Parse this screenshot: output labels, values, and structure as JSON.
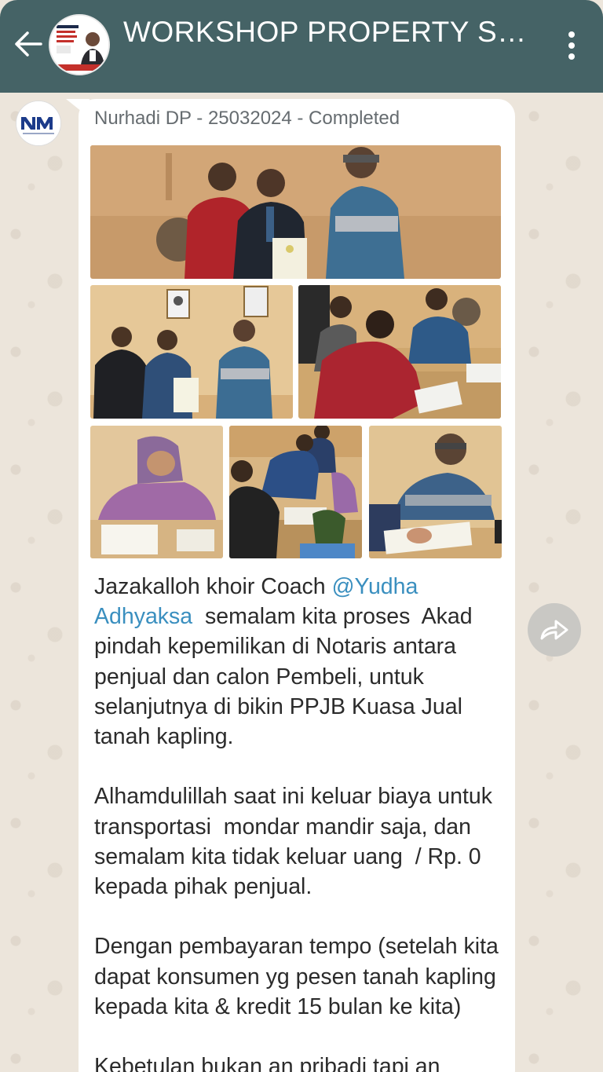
{
  "header": {
    "title": "WORKSHOP PROPERTY SYA...",
    "back_icon": "arrow-left-icon",
    "menu_icon": "more-vertical-icon",
    "background_color": "#456366"
  },
  "message": {
    "sender": "Nurhadi DP - 25032024 - Completed",
    "avatar_initials": "NM",
    "text_before_mention": "Jazakalloh khoir Coach ",
    "mention": "@Yudha Adhyaksa",
    "text_after_mention": "  semalam kita proses  Akad pindah kepemilikan di Notaris antara penjual dan calon Pembeli, untuk selanjutnya di bikin PPJB Kuasa Jual tanah kapling.\n\nAlhamdulillah saat ini keluar biaya untuk transportasi  mondar mandir saja, dan semalam kita tidak keluar uang  / Rp. 0  kepada pihak penjual.\n\nDengan pembayaran tempo (setelah kita dapat konsumen yg pesen tanah kapling kepada kita & kredit 15 bulan ke kita)\n\nKebetulan bukan an pribadi tapi an",
    "mention_color": "#3a8fbf"
  },
  "forward_icon": "forward-icon"
}
